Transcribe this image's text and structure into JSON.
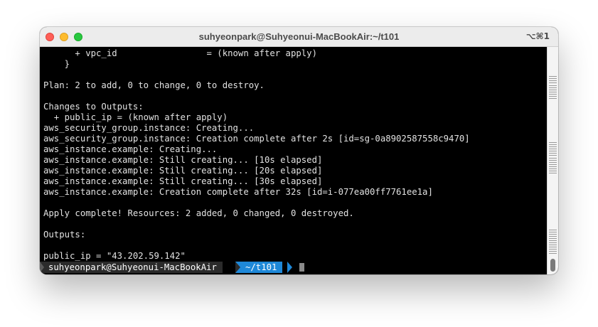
{
  "window": {
    "title": "suhyeonpark@Suhyeonui-MacBookAir:~/t101",
    "shortcut": "⌥⌘1"
  },
  "terminal": {
    "lines": [
      "      + vpc_id                 = (known after apply)",
      "    }",
      "",
      "Plan: 2 to add, 0 to change, 0 to destroy.",
      "",
      "Changes to Outputs:",
      "  + public_ip = (known after apply)",
      "aws_security_group.instance: Creating...",
      "aws_security_group.instance: Creation complete after 2s [id=sg-0a8902587558c9470]",
      "aws_instance.example: Creating...",
      "aws_instance.example: Still creating... [10s elapsed]",
      "aws_instance.example: Still creating... [20s elapsed]",
      "aws_instance.example: Still creating... [30s elapsed]",
      "aws_instance.example: Creation complete after 32s [id=i-077ea00ff7761ee1a]",
      "",
      "Apply complete! Resources: 2 added, 0 changed, 0 destroyed.",
      "",
      "Outputs:",
      "",
      "public_ip = \"43.202.59.142\""
    ],
    "prompt": {
      "user_host": "suhyeonpark@Suhyeonui-MacBookAir",
      "directory": "~/t101"
    }
  },
  "colors": {
    "background": "#000000",
    "text": "#e2e2e2",
    "prompt_user_bg": "#2b2b2b",
    "prompt_dir_bg": "#1e88d8"
  }
}
